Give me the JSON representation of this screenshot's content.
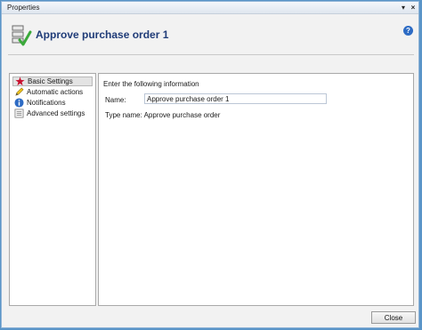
{
  "window": {
    "title": "Properties",
    "dropdown_glyph": "▾",
    "close_glyph": "×"
  },
  "header": {
    "title": "Approve purchase order 1",
    "icon": "workflow-approve-icon",
    "help_glyph": "?"
  },
  "nav": {
    "items": [
      {
        "label": "Basic Settings",
        "icon": "star-icon",
        "selected": true
      },
      {
        "label": "Automatic actions",
        "icon": "pencil-icon",
        "selected": false
      },
      {
        "label": "Notifications",
        "icon": "info-icon",
        "selected": false
      },
      {
        "label": "Advanced settings",
        "icon": "settings-list-icon",
        "selected": false
      }
    ]
  },
  "content": {
    "intro": "Enter the following information",
    "name_label": "Name:",
    "name_value": "Approve purchase order 1",
    "type_name": "Type name: Approve purchase order"
  },
  "footer": {
    "close_label": "Close"
  },
  "colors": {
    "title_blue": "#203c78",
    "star_red": "#c8102e",
    "info_blue": "#2d6bc4",
    "check_green": "#3aa93a"
  }
}
